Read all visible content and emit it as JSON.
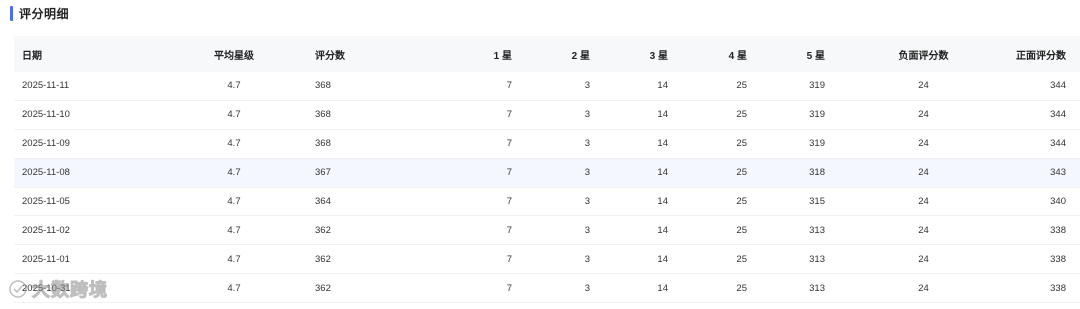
{
  "section": {
    "title": "评分明细"
  },
  "table": {
    "headers": {
      "date": "日期",
      "avg": "平均星级",
      "count": "评分数",
      "s1": "1 星",
      "s2": "2 星",
      "s3": "3 星",
      "s4": "4 星",
      "s5": "5 星",
      "neg": "负面评分数",
      "pos": "正面评分数"
    },
    "rows": [
      {
        "date": "2025-11-11",
        "avg": "4.7",
        "count": "368",
        "s1": "7",
        "s2": "3",
        "s3": "14",
        "s4": "25",
        "s5": "319",
        "neg": "24",
        "pos": "344"
      },
      {
        "date": "2025-11-10",
        "avg": "4.7",
        "count": "368",
        "s1": "7",
        "s2": "3",
        "s3": "14",
        "s4": "25",
        "s5": "319",
        "neg": "24",
        "pos": "344"
      },
      {
        "date": "2025-11-09",
        "avg": "4.7",
        "count": "368",
        "s1": "7",
        "s2": "3",
        "s3": "14",
        "s4": "25",
        "s5": "319",
        "neg": "24",
        "pos": "344"
      },
      {
        "date": "2025-11-08",
        "avg": "4.7",
        "count": "367",
        "s1": "7",
        "s2": "3",
        "s3": "14",
        "s4": "25",
        "s5": "318",
        "neg": "24",
        "pos": "343"
      },
      {
        "date": "2025-11-05",
        "avg": "4.7",
        "count": "364",
        "s1": "7",
        "s2": "3",
        "s3": "14",
        "s4": "25",
        "s5": "315",
        "neg": "24",
        "pos": "340"
      },
      {
        "date": "2025-11-02",
        "avg": "4.7",
        "count": "362",
        "s1": "7",
        "s2": "3",
        "s3": "14",
        "s4": "25",
        "s5": "313",
        "neg": "24",
        "pos": "338"
      },
      {
        "date": "2025-11-01",
        "avg": "4.7",
        "count": "362",
        "s1": "7",
        "s2": "3",
        "s3": "14",
        "s4": "25",
        "s5": "313",
        "neg": "24",
        "pos": "338"
      },
      {
        "date": "2025-10-31",
        "avg": "4.7",
        "count": "362",
        "s1": "7",
        "s2": "3",
        "s3": "14",
        "s4": "25",
        "s5": "313",
        "neg": "24",
        "pos": "338"
      }
    ]
  },
  "watermark": {
    "text": "大数跨境",
    "icon": "brand-logo-icon"
  },
  "colors": {
    "accent": "#4a6cf7",
    "header_bg": "#f7f8fa",
    "highlight_row": "#f4f7fe"
  }
}
